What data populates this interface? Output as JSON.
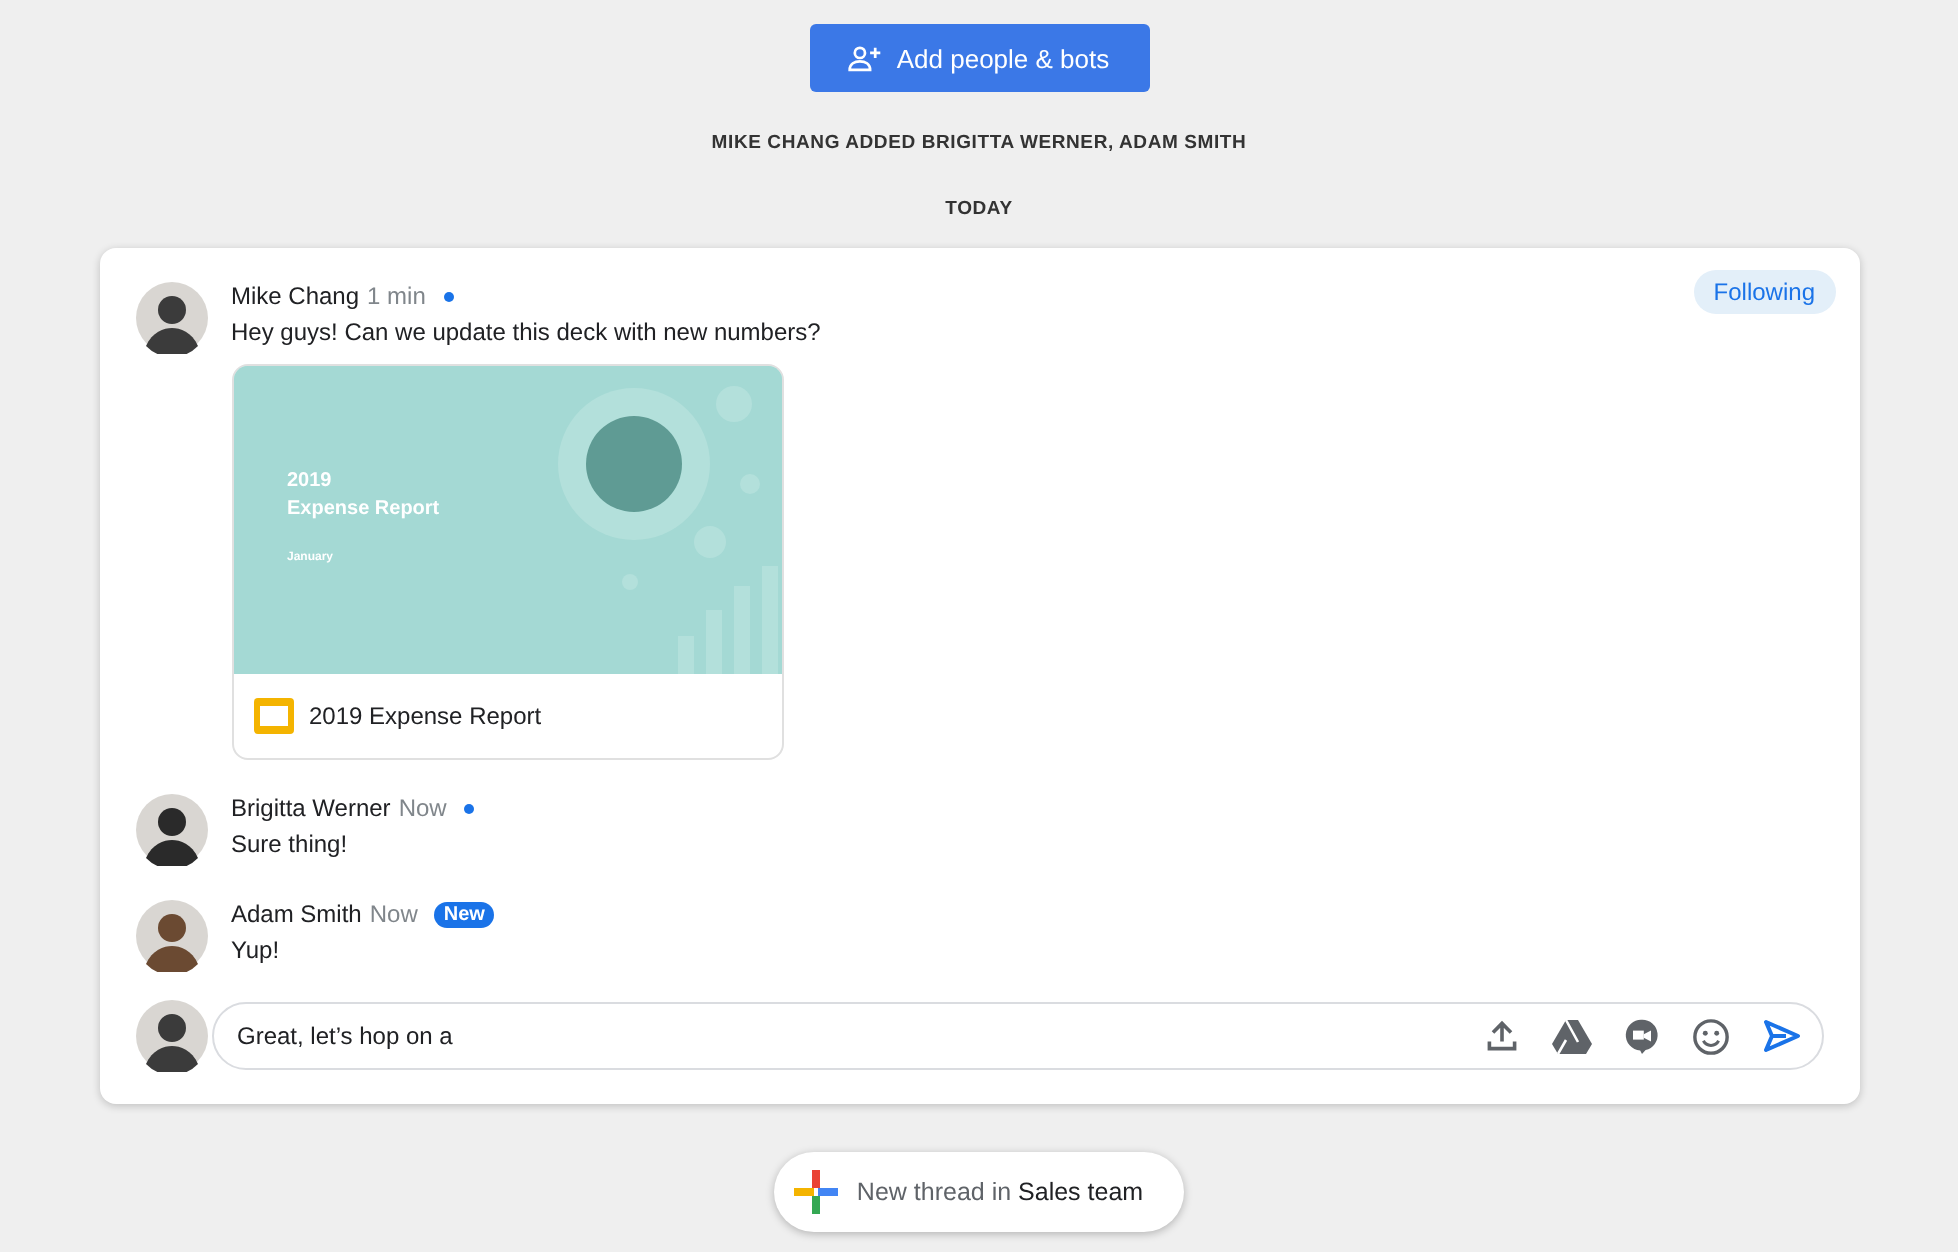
{
  "add_button": {
    "label": "Add people & bots"
  },
  "system_message": "MIKE CHANG ADDED BRIGITTA WERNER, ADAM SMITH",
  "date_divider": "TODAY",
  "thread": {
    "follow_chip": "Following",
    "messages": [
      {
        "author": "Mike Chang",
        "time": "1 min",
        "online": true,
        "text": "Hey guys! Can we update this deck with new numbers?",
        "attachment": {
          "slide_lines": [
            "2019",
            "Expense Report"
          ],
          "slide_subtitle": "January",
          "file_name": "2019 Expense Report"
        }
      },
      {
        "author": "Brigitta Werner",
        "time": "Now",
        "online": true,
        "text": "Sure thing!"
      },
      {
        "author": "Adam Smith",
        "time": "Now",
        "online": false,
        "badge": "New",
        "text": "Yup!"
      }
    ],
    "composer": {
      "value": "Great, let’s hop on a"
    }
  },
  "new_thread": {
    "text": "New thread in **Sales team**"
  }
}
